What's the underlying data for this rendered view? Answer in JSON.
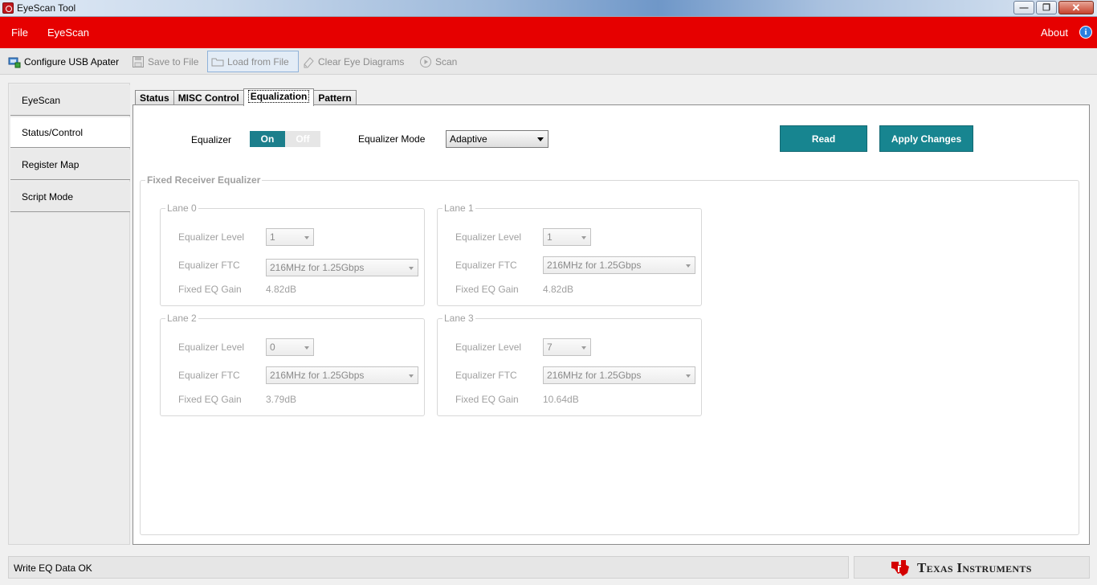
{
  "window": {
    "title": "EyeScan Tool"
  },
  "menu": {
    "items": [
      "File",
      "EyeScan"
    ],
    "about": "About"
  },
  "toolbar": {
    "configure": "Configure USB Apater",
    "save": "Save to File",
    "load": "Load from File",
    "clear": "Clear Eye Diagrams",
    "scan": "Scan"
  },
  "nav": {
    "items": [
      "EyeScan",
      "Status/Control",
      "Register Map",
      "Script Mode"
    ],
    "active_index": 1
  },
  "tabs": {
    "items": [
      "Status",
      "MISC Control",
      "Equalization",
      "Pattern"
    ],
    "active_index": 2
  },
  "equalization": {
    "equalizer_label": "Equalizer",
    "toggle_on": "On",
    "toggle_off": "Off",
    "mode_label": "Equalizer Mode",
    "mode_value": "Adaptive",
    "read_button": "Read",
    "apply_button": "Apply Changes",
    "fixed_title": "Fixed Receiver Equalizer",
    "row_labels": {
      "level": "Equalizer Level",
      "ftc": "Equalizer FTC",
      "gain": "Fixed EQ Gain"
    },
    "lanes": [
      {
        "title": "Lane 0",
        "level": "1",
        "ftc": "216MHz for 1.25Gbps",
        "gain": "4.82dB"
      },
      {
        "title": "Lane 1",
        "level": "1",
        "ftc": "216MHz for 1.25Gbps",
        "gain": "4.82dB"
      },
      {
        "title": "Lane 2",
        "level": "0",
        "ftc": "216MHz for 1.25Gbps",
        "gain": "3.79dB"
      },
      {
        "title": "Lane 3",
        "level": "7",
        "ftc": "216MHz for 1.25Gbps",
        "gain": "10.64dB"
      }
    ]
  },
  "status": {
    "message": "Write EQ Data OK"
  },
  "brand": {
    "logo_text": "Texas Instruments"
  },
  "colors": {
    "menu_red": "#e60000",
    "accent_teal": "#178590"
  }
}
